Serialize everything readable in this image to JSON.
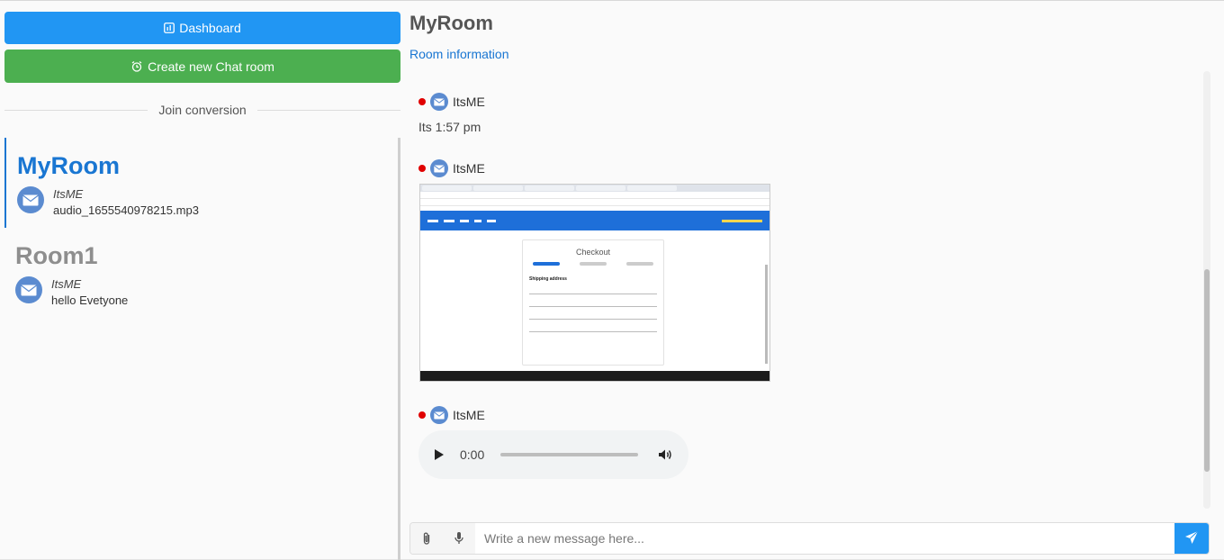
{
  "sidebar": {
    "dashboard_label": "Dashboard",
    "create_room_label": "Create new Chat room",
    "join_divider": "Join conversion",
    "rooms": [
      {
        "name": "MyRoom",
        "sender": "ItsME",
        "last_message": "audio_1655540978215.mp3",
        "active": true
      },
      {
        "name": "Room1",
        "sender": "ItsME",
        "last_message": "hello Evetyone",
        "active": false
      }
    ]
  },
  "chat": {
    "title": "MyRoom",
    "room_info_label": "Room information",
    "messages": [
      {
        "sender": "ItsME",
        "type": "text",
        "text": "Its 1:57 pm"
      },
      {
        "sender": "ItsME",
        "type": "image"
      },
      {
        "sender": "ItsME",
        "type": "audio",
        "time": "0:00"
      }
    ],
    "screenshot": {
      "checkout_title": "Checkout",
      "section": "Shipping address"
    }
  },
  "composer": {
    "placeholder": "Write a new message here..."
  },
  "colors": {
    "primary": "#2196f3",
    "success": "#4caf50",
    "active_room": "#1976d2",
    "online_dot": "#e00000"
  }
}
